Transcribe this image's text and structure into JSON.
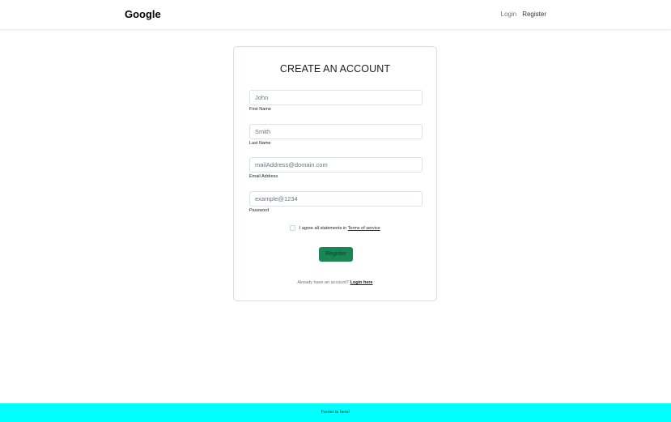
{
  "header": {
    "brand": "Google",
    "nav": {
      "login": "Login",
      "register": "Register"
    }
  },
  "form": {
    "title": "CREATE AN ACCOUNT",
    "fields": [
      {
        "placeholder": "John",
        "label": "First Name"
      },
      {
        "placeholder": "Smith",
        "label": "Last Name"
      },
      {
        "placeholder": "mailAddress@domain.com",
        "label": "Email Address"
      },
      {
        "placeholder": "example@1234",
        "label": "Password"
      }
    ],
    "terms": {
      "text": "I agree all statements in",
      "link": "Terms of service",
      "checked": false
    },
    "submit_label": "Register",
    "login_prompt": {
      "text": "Already have an account?",
      "link": "Login here"
    }
  },
  "footer": {
    "text": "Footer is here!"
  },
  "colors": {
    "button": "#198754",
    "footer": "#00ffff"
  }
}
